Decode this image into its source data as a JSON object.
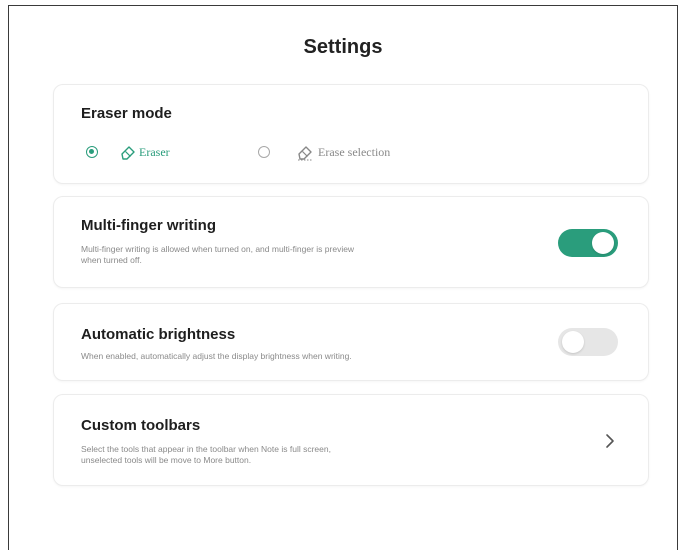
{
  "page": {
    "title": "Settings"
  },
  "eraser_mode": {
    "title": "Eraser mode",
    "options": [
      {
        "label": "Eraser",
        "icon": "eraser-icon",
        "selected": true
      },
      {
        "label": "Erase selection",
        "icon": "erase-selection-icon",
        "selected": false
      }
    ]
  },
  "multi_finger": {
    "title": "Multi-finger writing",
    "description_line1": "Multi-finger writing is allowed when turned on, and multi-finger is preview",
    "description_line2": "when turned off.",
    "enabled": true
  },
  "auto_brightness": {
    "title": "Automatic brightness",
    "description": "When enabled, automatically adjust the display brightness when writing.",
    "enabled": false
  },
  "custom_toolbars": {
    "title": "Custom toolbars",
    "description_line1": "Select the tools that appear in the toolbar when Note is full screen,",
    "description_line2": "unselected tools will be move to More button.",
    "icon": "chevron-right-icon"
  },
  "colors": {
    "accent": "#2a9d7c",
    "toggle_off": "#e6e6e6",
    "text_primary": "#1e1e1e",
    "text_secondary": "#8a8a8a"
  }
}
